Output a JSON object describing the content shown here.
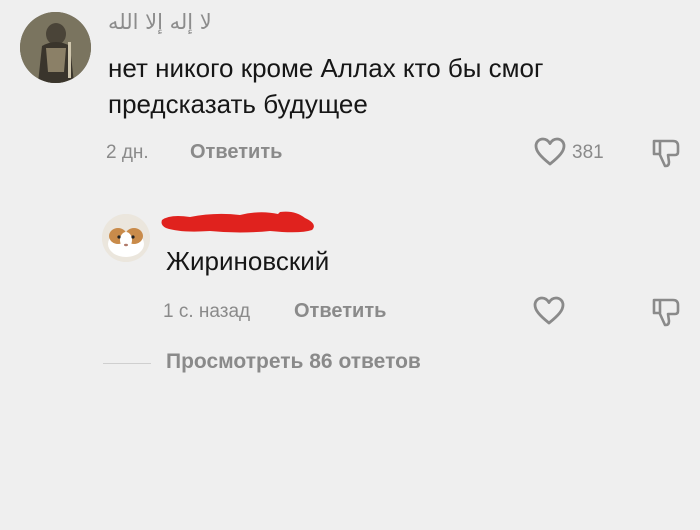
{
  "comments": [
    {
      "author": "لا إله إلا الله",
      "text_line1": "нет никого кроме Аллах кто бы смог",
      "text_line2": "предсказать будущее",
      "time": "2 дн.",
      "reply_label": "Ответить",
      "likes": "381",
      "like_icon": "heart-outline-icon",
      "dislike_icon": "thumbs-down-icon"
    },
    {
      "author": "",
      "text": "Жириновский",
      "time": "1 с. назад",
      "reply_label": "Ответить",
      "like_icon": "heart-outline-icon",
      "dislike_icon": "thumbs-down-icon"
    }
  ],
  "view_replies_label": "Просмотреть 86 ответов",
  "colors": {
    "background": "#efefef",
    "text": "#161616",
    "muted": "#8a8a8a",
    "redaction": "#e0221e"
  }
}
